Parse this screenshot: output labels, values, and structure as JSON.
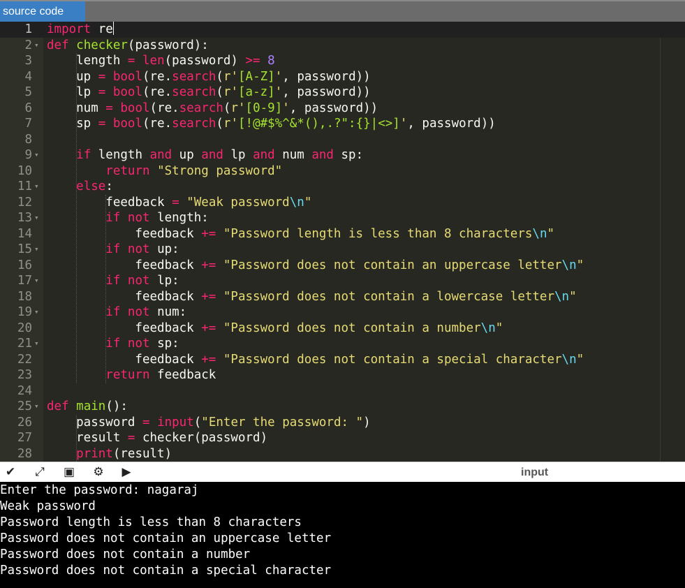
{
  "tab": {
    "label": "source code"
  },
  "editor": {
    "lines": [
      {
        "n": "1",
        "fold": false,
        "tokens": [
          [
            "k",
            "import"
          ],
          [
            "p",
            " re"
          ]
        ]
      },
      {
        "n": "2",
        "fold": true,
        "tokens": [
          [
            "k",
            "def"
          ],
          [
            "p",
            " "
          ],
          [
            "fn",
            "checker"
          ],
          [
            "p",
            "(password):"
          ]
        ]
      },
      {
        "n": "3",
        "fold": false,
        "tokens": [
          [
            "p",
            "    length "
          ],
          [
            "k",
            "="
          ],
          [
            "p",
            " "
          ],
          [
            "bi",
            "len"
          ],
          [
            "p",
            "(password) "
          ],
          [
            "k",
            ">="
          ],
          [
            "p",
            " "
          ],
          [
            "n",
            "8"
          ]
        ]
      },
      {
        "n": "4",
        "fold": false,
        "tokens": [
          [
            "p",
            "    up "
          ],
          [
            "k",
            "="
          ],
          [
            "p",
            " "
          ],
          [
            "bi",
            "bool"
          ],
          [
            "p",
            "(re."
          ],
          [
            "bi",
            "search"
          ],
          [
            "p",
            "("
          ],
          [
            "s",
            "r'"
          ],
          [
            "rx",
            "[A-Z]"
          ],
          [
            "s",
            "'"
          ],
          [
            "p",
            ", password))"
          ]
        ]
      },
      {
        "n": "5",
        "fold": false,
        "tokens": [
          [
            "p",
            "    lp "
          ],
          [
            "k",
            "="
          ],
          [
            "p",
            " "
          ],
          [
            "bi",
            "bool"
          ],
          [
            "p",
            "(re."
          ],
          [
            "bi",
            "search"
          ],
          [
            "p",
            "("
          ],
          [
            "s",
            "r'"
          ],
          [
            "rx",
            "[a-z]"
          ],
          [
            "s",
            "'"
          ],
          [
            "p",
            ", password))"
          ]
        ]
      },
      {
        "n": "6",
        "fold": false,
        "tokens": [
          [
            "p",
            "    num "
          ],
          [
            "k",
            "="
          ],
          [
            "p",
            " "
          ],
          [
            "bi",
            "bool"
          ],
          [
            "p",
            "(re."
          ],
          [
            "bi",
            "search"
          ],
          [
            "p",
            "("
          ],
          [
            "s",
            "r'"
          ],
          [
            "rx",
            "[0-9]"
          ],
          [
            "s",
            "'"
          ],
          [
            "p",
            ", password))"
          ]
        ]
      },
      {
        "n": "7",
        "fold": false,
        "tokens": [
          [
            "p",
            "    sp "
          ],
          [
            "k",
            "="
          ],
          [
            "p",
            " "
          ],
          [
            "bi",
            "bool"
          ],
          [
            "p",
            "(re."
          ],
          [
            "bi",
            "search"
          ],
          [
            "p",
            "("
          ],
          [
            "s",
            "r'"
          ],
          [
            "rx",
            "[!@#$%^&*(),.?\":{}|<>]"
          ],
          [
            "s",
            "'"
          ],
          [
            "p",
            ", password))"
          ]
        ]
      },
      {
        "n": "8",
        "fold": false,
        "tokens": []
      },
      {
        "n": "9",
        "fold": true,
        "tokens": [
          [
            "p",
            "    "
          ],
          [
            "k",
            "if"
          ],
          [
            "p",
            " length "
          ],
          [
            "k",
            "and"
          ],
          [
            "p",
            " up "
          ],
          [
            "k",
            "and"
          ],
          [
            "p",
            " lp "
          ],
          [
            "k",
            "and"
          ],
          [
            "p",
            " num "
          ],
          [
            "k",
            "and"
          ],
          [
            "p",
            " sp:"
          ]
        ]
      },
      {
        "n": "10",
        "fold": false,
        "tokens": [
          [
            "p",
            "        "
          ],
          [
            "k",
            "return"
          ],
          [
            "p",
            " "
          ],
          [
            "s",
            "\"Strong password\""
          ]
        ]
      },
      {
        "n": "11",
        "fold": true,
        "tokens": [
          [
            "p",
            "    "
          ],
          [
            "k",
            "else"
          ],
          [
            "p",
            ":"
          ]
        ]
      },
      {
        "n": "12",
        "fold": false,
        "tokens": [
          [
            "p",
            "        feedback "
          ],
          [
            "k",
            "="
          ],
          [
            "p",
            " "
          ],
          [
            "s",
            "\"Weak password"
          ],
          [
            "esc",
            "\\n"
          ],
          [
            "s",
            "\""
          ]
        ]
      },
      {
        "n": "13",
        "fold": true,
        "tokens": [
          [
            "p",
            "        "
          ],
          [
            "k",
            "if"
          ],
          [
            "p",
            " "
          ],
          [
            "k",
            "not"
          ],
          [
            "p",
            " length:"
          ]
        ]
      },
      {
        "n": "14",
        "fold": false,
        "tokens": [
          [
            "p",
            "            feedback "
          ],
          [
            "k",
            "+="
          ],
          [
            "p",
            " "
          ],
          [
            "s",
            "\"Password length is less than 8 characters"
          ],
          [
            "esc",
            "\\n"
          ],
          [
            "s",
            "\""
          ]
        ]
      },
      {
        "n": "15",
        "fold": true,
        "tokens": [
          [
            "p",
            "        "
          ],
          [
            "k",
            "if"
          ],
          [
            "p",
            " "
          ],
          [
            "k",
            "not"
          ],
          [
            "p",
            " up:"
          ]
        ]
      },
      {
        "n": "16",
        "fold": false,
        "tokens": [
          [
            "p",
            "            feedback "
          ],
          [
            "k",
            "+="
          ],
          [
            "p",
            " "
          ],
          [
            "s",
            "\"Password does not contain an uppercase letter"
          ],
          [
            "esc",
            "\\n"
          ],
          [
            "s",
            "\""
          ]
        ]
      },
      {
        "n": "17",
        "fold": true,
        "tokens": [
          [
            "p",
            "        "
          ],
          [
            "k",
            "if"
          ],
          [
            "p",
            " "
          ],
          [
            "k",
            "not"
          ],
          [
            "p",
            " lp:"
          ]
        ]
      },
      {
        "n": "18",
        "fold": false,
        "tokens": [
          [
            "p",
            "            feedback "
          ],
          [
            "k",
            "+="
          ],
          [
            "p",
            " "
          ],
          [
            "s",
            "\"Password does not contain a lowercase letter"
          ],
          [
            "esc",
            "\\n"
          ],
          [
            "s",
            "\""
          ]
        ]
      },
      {
        "n": "19",
        "fold": true,
        "tokens": [
          [
            "p",
            "        "
          ],
          [
            "k",
            "if"
          ],
          [
            "p",
            " "
          ],
          [
            "k",
            "not"
          ],
          [
            "p",
            " num:"
          ]
        ]
      },
      {
        "n": "20",
        "fold": false,
        "tokens": [
          [
            "p",
            "            feedback "
          ],
          [
            "k",
            "+="
          ],
          [
            "p",
            " "
          ],
          [
            "s",
            "\"Password does not contain a number"
          ],
          [
            "esc",
            "\\n"
          ],
          [
            "s",
            "\""
          ]
        ]
      },
      {
        "n": "21",
        "fold": true,
        "tokens": [
          [
            "p",
            "        "
          ],
          [
            "k",
            "if"
          ],
          [
            "p",
            " "
          ],
          [
            "k",
            "not"
          ],
          [
            "p",
            " sp:"
          ]
        ]
      },
      {
        "n": "22",
        "fold": false,
        "tokens": [
          [
            "p",
            "            feedback "
          ],
          [
            "k",
            "+="
          ],
          [
            "p",
            " "
          ],
          [
            "s",
            "\"Password does not contain a special character"
          ],
          [
            "esc",
            "\\n"
          ],
          [
            "s",
            "\""
          ]
        ]
      },
      {
        "n": "23",
        "fold": false,
        "tokens": [
          [
            "p",
            "        "
          ],
          [
            "k",
            "return"
          ],
          [
            "p",
            " feedback"
          ]
        ]
      },
      {
        "n": "24",
        "fold": false,
        "tokens": []
      },
      {
        "n": "25",
        "fold": true,
        "tokens": [
          [
            "k",
            "def"
          ],
          [
            "p",
            " "
          ],
          [
            "fn",
            "main"
          ],
          [
            "p",
            "():"
          ]
        ]
      },
      {
        "n": "26",
        "fold": false,
        "tokens": [
          [
            "p",
            "    password "
          ],
          [
            "k",
            "="
          ],
          [
            "p",
            " "
          ],
          [
            "bi",
            "input"
          ],
          [
            "p",
            "("
          ],
          [
            "s",
            "\"Enter the password: \""
          ],
          [
            "p",
            ")"
          ]
        ]
      },
      {
        "n": "27",
        "fold": false,
        "tokens": [
          [
            "p",
            "    result "
          ],
          [
            "k",
            "="
          ],
          [
            "p",
            " checker(password)"
          ]
        ]
      },
      {
        "n": "28",
        "fold": false,
        "tokens": [
          [
            "p",
            "    "
          ],
          [
            "bi",
            "print"
          ],
          [
            "p",
            "(result)"
          ]
        ]
      }
    ]
  },
  "toolbar": {
    "buttons": [
      {
        "name": "collapse-button",
        "icon": "chevron-down-icon",
        "glyph": "✔"
      },
      {
        "name": "fullscreen-button",
        "icon": "expand-icon",
        "glyph": "⤢"
      },
      {
        "name": "layout-button",
        "icon": "layout-icon",
        "glyph": "▣"
      },
      {
        "name": "settings-button",
        "icon": "gear-icon",
        "glyph": "⚙"
      },
      {
        "name": "run-button",
        "icon": "run-icon",
        "glyph": "▶"
      }
    ],
    "input_label": "input"
  },
  "output": {
    "lines": [
      "Enter the password: nagaraj",
      "Weak password",
      "Password length is less than 8 characters",
      "Password does not contain an uppercase letter",
      "Password does not contain a number",
      "Password does not contain a special character"
    ]
  },
  "colors": {
    "editor_bg": "#272822",
    "tab_active": "#3a7fc4",
    "keyword": "#f92672",
    "function": "#a6e22e",
    "string": "#e6db74",
    "number": "#ae81ff"
  }
}
